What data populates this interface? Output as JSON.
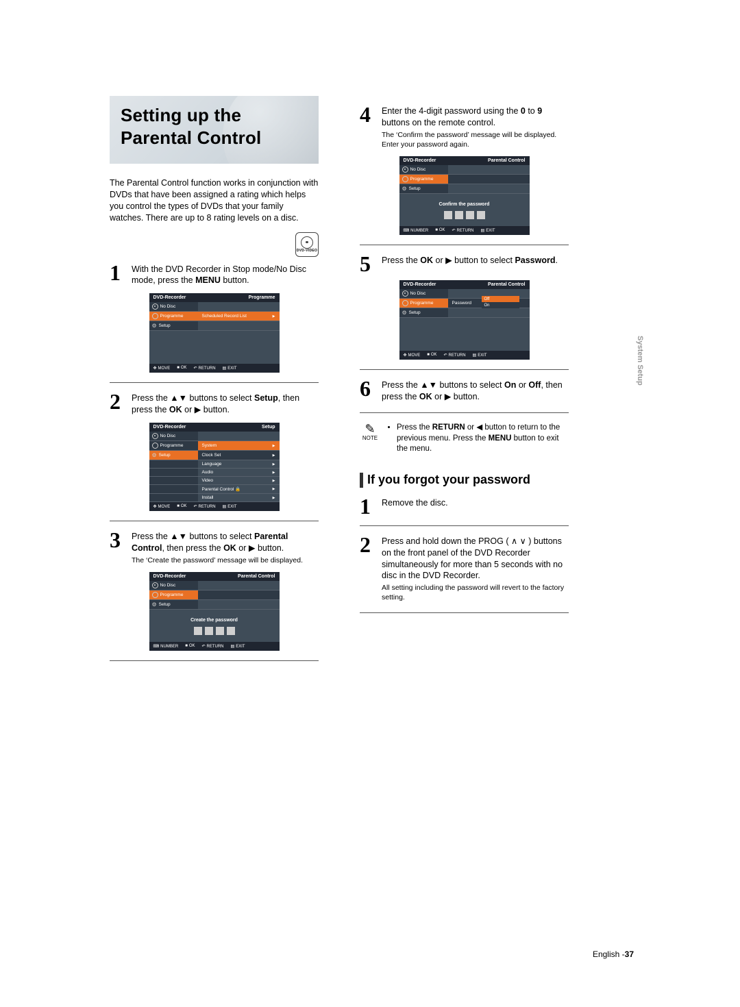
{
  "title": "Setting up the Parental Control",
  "intro": "The Parental Control function works in conjunction with DVDs that have been assigned a rating which helps you control the types of DVDs that your family watches. There are up to 8 rating levels on a disc.",
  "dvd_icon_label": "DVD-VIDEO",
  "side_tab": "System Setup",
  "footer_lang": "English -",
  "footer_page": "37",
  "steps_left": {
    "s1": {
      "num": "1",
      "text_a": "With the DVD Recorder in Stop mode/No Disc mode, press the ",
      "b": "MENU",
      "text_b": " button."
    },
    "s2": {
      "num": "2",
      "pre": "Press the ",
      "sym": "▲▼",
      "mid": " buttons to select ",
      "b1": "Setup",
      "post": ", then press the ",
      "b2": "OK",
      "post2": " or ",
      "sym2": "▶",
      "post3": " button."
    },
    "s3": {
      "num": "3",
      "text": "Press the ▲▼ buttons to select ",
      "b1": "Parental Control",
      "mid": ", then press the ",
      "b2": "OK",
      "post": " or ▶ button.",
      "sub": "The ‘Create the password’ message will be displayed."
    }
  },
  "steps_right": {
    "s4": {
      "num": "4",
      "text": "Enter the 4-digit password using the ",
      "b1": "0",
      "mid": " to ",
      "b2": "9",
      "post": " buttons on the remote control.",
      "sub": "The ‘Confirm the password’ message will be displayed. Enter your password again."
    },
    "s5": {
      "num": "5",
      "pre": "Press the ",
      "b1": "OK",
      "mid": " or ▶ button to select ",
      "b2": "Password",
      "post": "."
    },
    "s6": {
      "num": "6",
      "text": "Press the ▲▼ buttons to select ",
      "b1": "On",
      "mid": " or ",
      "b2": "Off",
      "post": ", then press the ",
      "b3": "OK",
      "post2": " or ▶ button."
    }
  },
  "note": {
    "label": "NOTE",
    "text": "Press the ",
    "b1": "RETURN",
    "mid": " or ◀ button to return to the previous menu. Press the ",
    "b2": "MENU",
    "post": " button to exit the menu."
  },
  "forgot_heading": "If you forgot your password",
  "forgot": {
    "f1": {
      "num": "1",
      "text": "Remove the disc."
    },
    "f2": {
      "num": "2",
      "text": "Press and hold down the PROG ( ∧ ∨ ) buttons on the front panel of the DVD Recorder simultaneously for more than 5 seconds with no disc in the DVD Recorder.",
      "sub": "All setting including the password will revert to the factory setting."
    }
  },
  "screens": {
    "common": {
      "title": "DVD-Recorder",
      "nodisc": "No Disc",
      "programme": "Programme",
      "setup": "Setup",
      "scheduled": "Scheduled Record List",
      "foot_move": "MOVE",
      "foot_ok": "OK",
      "foot_return": "RETURN",
      "foot_exit": "EXIT",
      "foot_number": "NUMBER"
    },
    "s1_right_title": "Programme",
    "s2_right_title": "Setup",
    "s2_items": [
      "System",
      "Clock Set",
      "Language",
      "Audio",
      "Video",
      "Parental Control 🔒",
      "Install"
    ],
    "s3_right_title": "Parental Control",
    "s3_msg": "Create the password",
    "s4_right_title": "Parental Control",
    "s4_msg": "Confirm the password",
    "s5_right_title": "Parental Control",
    "s5_password": "Password",
    "s5_off": "Off",
    "s5_on": "On"
  }
}
